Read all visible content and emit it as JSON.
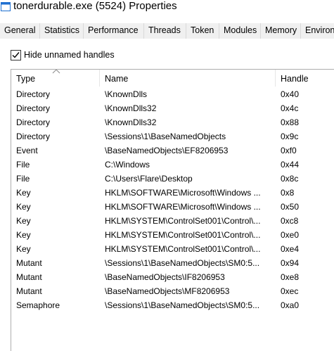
{
  "window": {
    "title": "tonerdurable.exe (5524) Properties"
  },
  "tabs": [
    {
      "label": "General"
    },
    {
      "label": "Statistics"
    },
    {
      "label": "Performance"
    },
    {
      "label": "Threads"
    },
    {
      "label": "Token"
    },
    {
      "label": "Modules"
    },
    {
      "label": "Memory"
    },
    {
      "label": "Environment"
    }
  ],
  "options": {
    "hide_unnamed_label": "Hide unnamed handles",
    "hide_unnamed_checked": true
  },
  "handles": {
    "columns": {
      "type": "Type",
      "name": "Name",
      "handle": "Handle"
    },
    "rows": [
      {
        "type": "Directory",
        "name": "\\KnownDlls",
        "handle": "0x40"
      },
      {
        "type": "Directory",
        "name": "\\KnownDlls32",
        "handle": "0x4c"
      },
      {
        "type": "Directory",
        "name": "\\KnownDlls32",
        "handle": "0x88"
      },
      {
        "type": "Directory",
        "name": "\\Sessions\\1\\BaseNamedObjects",
        "handle": "0x9c"
      },
      {
        "type": "Event",
        "name": "\\BaseNamedObjects\\EF8206953",
        "handle": "0xf0"
      },
      {
        "type": "File",
        "name": "C:\\Windows",
        "handle": "0x44"
      },
      {
        "type": "File",
        "name": "C:\\Users\\Flare\\Desktop",
        "handle": "0x8c"
      },
      {
        "type": "Key",
        "name": "HKLM\\SOFTWARE\\Microsoft\\Windows ...",
        "handle": "0x8"
      },
      {
        "type": "Key",
        "name": "HKLM\\SOFTWARE\\Microsoft\\Windows ...",
        "handle": "0x50"
      },
      {
        "type": "Key",
        "name": "HKLM\\SYSTEM\\ControlSet001\\Control\\...",
        "handle": "0xc8"
      },
      {
        "type": "Key",
        "name": "HKLM\\SYSTEM\\ControlSet001\\Control\\...",
        "handle": "0xe0"
      },
      {
        "type": "Key",
        "name": "HKLM\\SYSTEM\\ControlSet001\\Control\\...",
        "handle": "0xe4"
      },
      {
        "type": "Mutant",
        "name": "\\Sessions\\1\\BaseNamedObjects\\SM0:5...",
        "handle": "0x94"
      },
      {
        "type": "Mutant",
        "name": "\\BaseNamedObjects\\IF8206953",
        "handle": "0xe8"
      },
      {
        "type": "Mutant",
        "name": "\\BaseNamedObjects\\MF8206953",
        "handle": "0xec"
      },
      {
        "type": "Semaphore",
        "name": "\\Sessions\\1\\BaseNamedObjects\\SM0:5...",
        "handle": "0xa0"
      }
    ]
  },
  "icons": {
    "title": "window-app-icon",
    "checkbox": "checkmark-icon",
    "sort": "sort-ascending-icon"
  },
  "colors": {
    "tab_background": "#f0f0f0",
    "window_background": "#ffffff",
    "app_icon_blue": "#1e6fd0"
  }
}
